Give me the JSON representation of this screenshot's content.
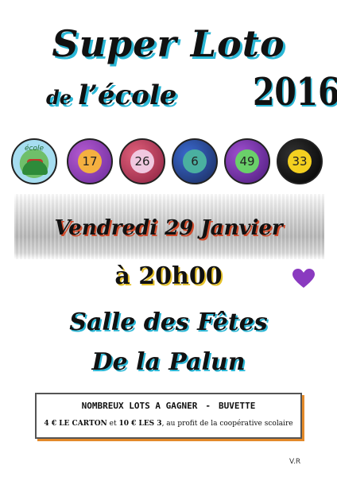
{
  "title": {
    "main": "Super Loto",
    "sub_prefix": "de",
    "sub_main": "l’école",
    "year": "2016"
  },
  "balls": [
    {
      "label": "école",
      "kind": "logo",
      "color": "#a6ddf0"
    },
    {
      "label": "17",
      "kind": "number",
      "color": "#e08a3a"
    },
    {
      "label": "26",
      "kind": "number",
      "color": "#c0308a"
    },
    {
      "label": "6",
      "kind": "number",
      "color": "#2a8a7a"
    },
    {
      "label": "49",
      "kind": "number",
      "color": "#3a9a3a"
    },
    {
      "label": "33",
      "kind": "number",
      "color": "#111111"
    }
  ],
  "event": {
    "date": "Vendredi 29 Janvier",
    "time": "à 20h00",
    "venue_line1": "Salle des Fêtes",
    "venue_line2": "De la Palun"
  },
  "info": {
    "line1_left": "NOMBREUX LOTS A GAGNER",
    "line1_sep": "-",
    "line1_right": "BUVETTE",
    "line2_bold1": "4 € LE CARTON",
    "line2_mid": " et ",
    "line2_bold2": "10 € LES 3",
    "line2_rest": ", au profit de la coopérative scolaire"
  },
  "signature": "V.R",
  "colors": {
    "accent_cyan": "#2ab7d6",
    "accent_red": "#d24a2a",
    "accent_yellow": "#e6c229",
    "accent_orange": "#e48a2a",
    "heart": "#8a3ac0"
  }
}
